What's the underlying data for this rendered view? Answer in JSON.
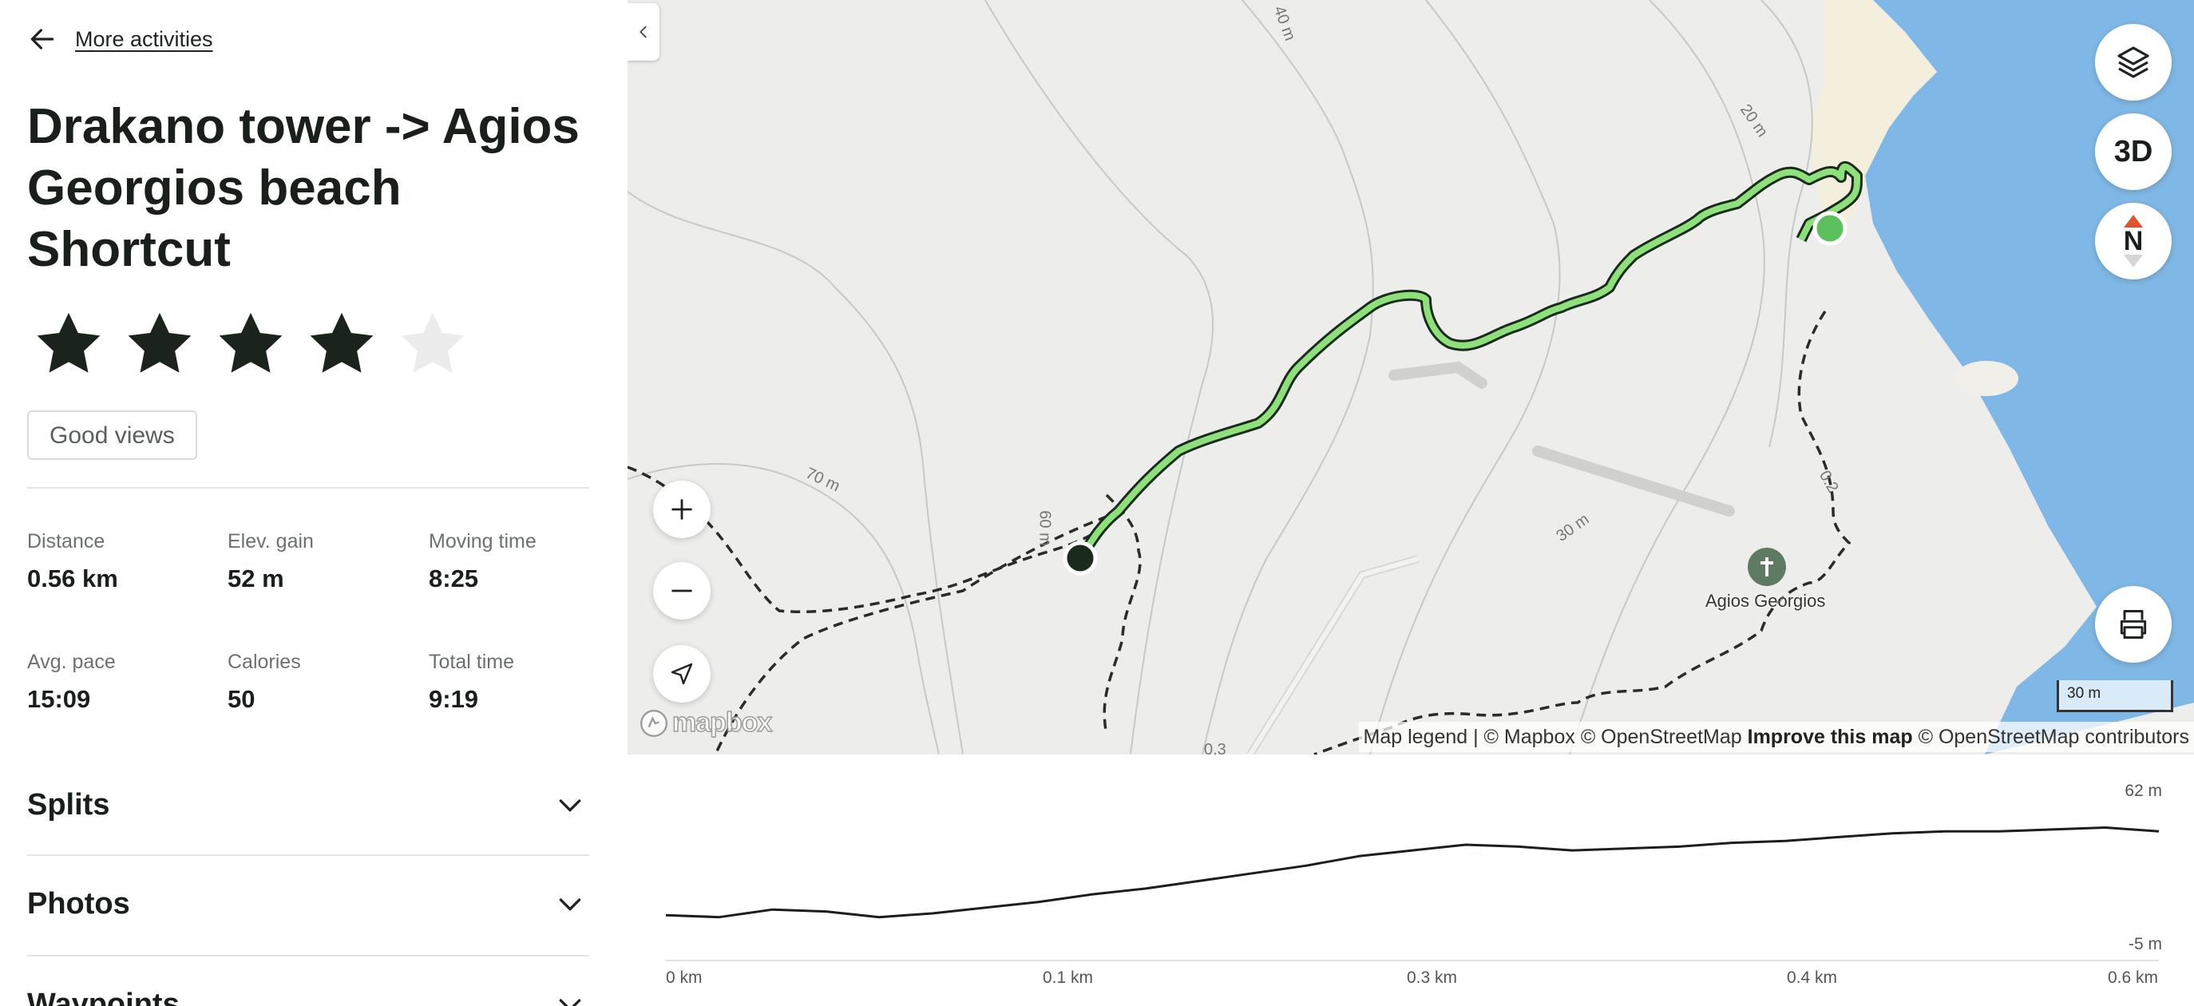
{
  "nav": {
    "back_label": "More activities"
  },
  "activity": {
    "title": "Drakano tower -> Agios Georgios beach Shortcut",
    "rating": 4,
    "rating_max": 5,
    "tag": "Good views"
  },
  "stats": [
    {
      "label": "Distance",
      "value": "0.56 km"
    },
    {
      "label": "Elev. gain",
      "value": "52 m"
    },
    {
      "label": "Moving time",
      "value": "8:25"
    },
    {
      "label": "Avg. pace",
      "value": "15:09"
    },
    {
      "label": "Calories",
      "value": "50"
    },
    {
      "label": "Total time",
      "value": "9:19"
    }
  ],
  "sections": [
    {
      "label": "Splits"
    },
    {
      "label": "Photos"
    },
    {
      "label": "Waypoints"
    }
  ],
  "map": {
    "controls": {
      "three_d": "3D",
      "north": "N"
    },
    "scale_label": "30 m",
    "attribution": {
      "legend": "Map legend",
      "sep": " | ",
      "mapbox": "© Mapbox",
      "osm": "© OpenStreetMap",
      "improve": "Improve this map",
      "contributors": "© OpenStreetMap contributors"
    },
    "logo": "mapbox",
    "poi": "Agios Georgios",
    "contour_labels": [
      "40 m",
      "20 m",
      "70 m",
      "60 m",
      "30 m",
      "0.2",
      "0.3"
    ],
    "colors": {
      "route": "#8ee07a",
      "water": "#7fb8e6",
      "start": "#5cc05c",
      "end": "#1a2b1e"
    }
  },
  "elevation": {
    "y_max_label": "62 m",
    "y_min_label": "-5 m",
    "x_labels": [
      "0 km",
      "0.1 km",
      "0.3 km",
      "0.4 km",
      "0.6 km"
    ]
  },
  "chart_data": {
    "type": "area",
    "xlabel": "",
    "ylabel": "",
    "ylim": [
      -5,
      62
    ],
    "xlim": [
      0,
      0.56
    ],
    "series": [
      {
        "x": [
          0,
          0.02,
          0.04,
          0.06,
          0.08,
          0.1,
          0.12,
          0.14,
          0.16,
          0.18,
          0.2,
          0.22,
          0.24,
          0.26,
          0.28,
          0.3,
          0.32,
          0.34,
          0.36,
          0.38,
          0.4,
          0.42,
          0.44,
          0.46,
          0.48,
          0.5,
          0.52,
          0.54,
          0.56
        ],
        "y": [
          7,
          6,
          10,
          9,
          6,
          8,
          11,
          14,
          18,
          21,
          25,
          29,
          33,
          38,
          41,
          44,
          43,
          41,
          42,
          43,
          45,
          46,
          48,
          50,
          51,
          51,
          52,
          53,
          51
        ]
      }
    ]
  }
}
